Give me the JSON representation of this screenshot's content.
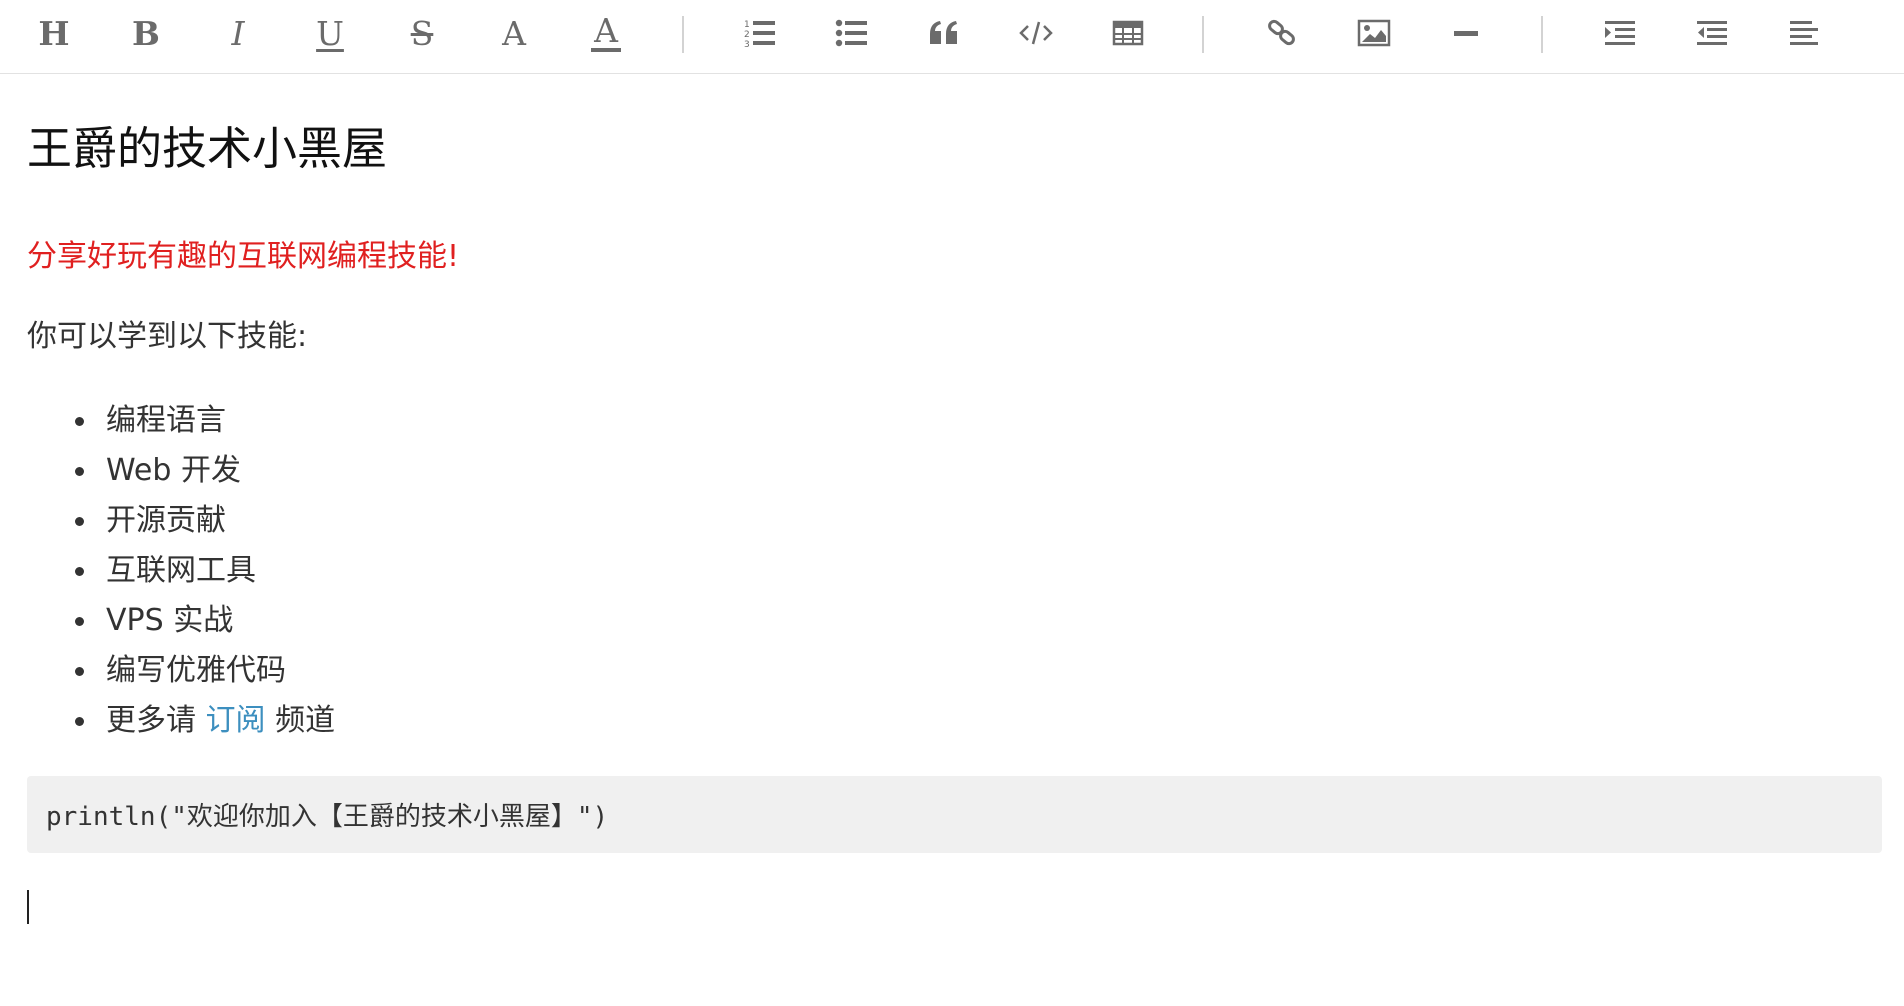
{
  "toolbar": {
    "buttons": [
      {
        "name": "heading",
        "glyph": "H",
        "icon": "heading-icon"
      },
      {
        "name": "bold",
        "glyph": "B",
        "icon": "bold-icon"
      },
      {
        "name": "italic",
        "glyph": "I",
        "icon": "italic-icon"
      },
      {
        "name": "underline",
        "glyph": "U",
        "icon": "underline-icon"
      },
      {
        "name": "strikethrough",
        "glyph": "S",
        "icon": "strikethrough-icon"
      },
      {
        "name": "font-size",
        "glyph": "A",
        "icon": "font-size-icon"
      },
      {
        "name": "font-color",
        "glyph": "A",
        "icon": "font-color-icon"
      },
      {
        "name": "ordered-list",
        "icon": "ordered-list-icon"
      },
      {
        "name": "unordered-list",
        "icon": "unordered-list-icon"
      },
      {
        "name": "blockquote",
        "icon": "quote-icon"
      },
      {
        "name": "code",
        "icon": "code-icon"
      },
      {
        "name": "table",
        "icon": "table-icon"
      },
      {
        "name": "link",
        "icon": "link-icon"
      },
      {
        "name": "image",
        "icon": "image-icon"
      },
      {
        "name": "horizontal-rule",
        "icon": "horizontal-rule-icon"
      },
      {
        "name": "indent",
        "icon": "indent-icon"
      },
      {
        "name": "outdent",
        "icon": "outdent-icon"
      },
      {
        "name": "align",
        "icon": "align-left-icon"
      }
    ]
  },
  "document": {
    "title": "王爵的技术小黑屋",
    "tagline": "分享好玩有趣的互联网编程技能!",
    "intro": "你可以学到以下技能:",
    "skills": [
      "编程语言",
      "Web 开发",
      "开源贡献",
      "互联网工具",
      "VPS 实战",
      "编写优雅代码"
    ],
    "last_item": {
      "prefix": "更多请",
      "link_text": "订阅",
      "suffix": "频道"
    },
    "code": "println(\"欢迎你加入【王爵的技术小黑屋】\")"
  },
  "colors": {
    "toolbar_icon": "#6b6b6b",
    "tagline": "#e02020",
    "link": "#3d8fbf",
    "code_background": "#f0f0f0"
  }
}
